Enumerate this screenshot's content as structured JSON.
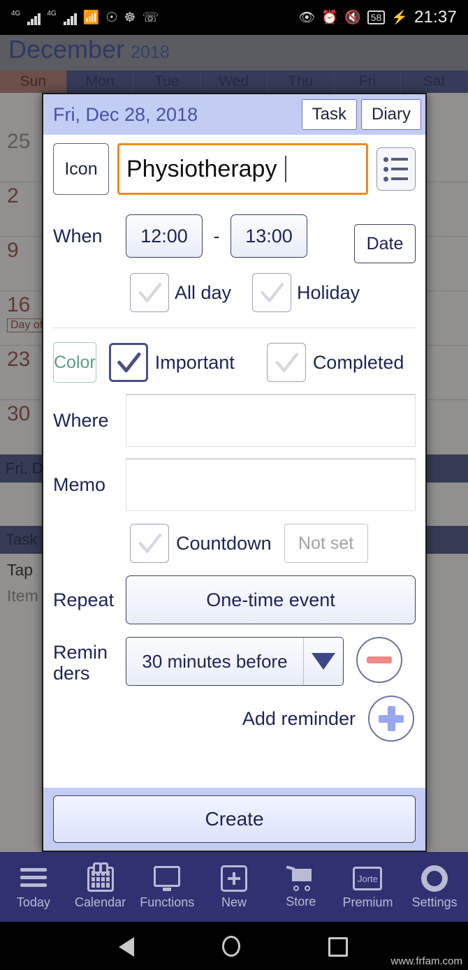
{
  "status_bar": {
    "network_label": "4G",
    "icons": [
      "signal-4g-1",
      "signal-4g-2",
      "wifi-icon",
      "whatsapp-icon",
      "contacts-icon",
      "phone-icon"
    ],
    "right_icons": [
      "eye-icon",
      "alarm-icon",
      "mute-icon"
    ],
    "battery": "58",
    "charging_icon": "charging-bolt",
    "time": "21:37"
  },
  "calendar": {
    "month": "December",
    "year": "2018",
    "day_headers": [
      "Sun",
      "Mon",
      "Tue",
      "Wed",
      "Thu",
      "Fri",
      "Sat"
    ],
    "week_numbers": [
      "25",
      "2",
      "9",
      "16",
      "23",
      "30"
    ],
    "day_of_chip": "Day of",
    "band_label": "Fri, D",
    "task_label": "Task",
    "tap_label": "Tap",
    "item_label": "Item"
  },
  "dialog": {
    "header": {
      "date": "Fri, Dec 28, 2018",
      "task_button": "Task",
      "diary_button": "Diary"
    },
    "title_row": {
      "icon_button": "Icon",
      "title_value": "Physiotherapy",
      "template_icon": "list-template-icon"
    },
    "when": {
      "label": "When",
      "start_time": "12:00",
      "separator": "-",
      "end_time": "13:00",
      "date_button": "Date",
      "all_day": {
        "label": "All day",
        "checked": false
      },
      "holiday": {
        "label": "Holiday",
        "checked": false
      }
    },
    "flags": {
      "color_button": "Color",
      "color_button_color": "#5a9e8a",
      "important": {
        "label": "Important",
        "checked": true
      },
      "completed": {
        "label": "Completed",
        "checked": false
      }
    },
    "where": {
      "label": "Where",
      "value": ""
    },
    "memo": {
      "label": "Memo",
      "value": ""
    },
    "countdown": {
      "label": "Countdown",
      "checked": false,
      "value_button": "Not set"
    },
    "repeat": {
      "label": "Repeat",
      "value": "One-time event"
    },
    "reminders": {
      "label": "Remin\nders",
      "label_line1": "Remin",
      "label_line2": "ders",
      "value": "30 minutes before",
      "dropdown_icon": "chevron-down-icon",
      "remove_icon": "minus-circle-icon",
      "add_label": "Add reminder",
      "add_icon": "plus-circle-icon"
    },
    "footer": {
      "create_button": "Create"
    }
  },
  "bottom_nav": [
    {
      "label": "Today",
      "icon": "hamburger-icon"
    },
    {
      "label": "Calendar",
      "icon": "calendar-icon"
    },
    {
      "label": "Functions",
      "icon": "monitor-icon"
    },
    {
      "label": "New",
      "icon": "plus-square-icon"
    },
    {
      "label": "Store",
      "icon": "cart-icon"
    },
    {
      "label": "Premium",
      "icon": "jorte-book-icon"
    },
    {
      "label": "Settings",
      "icon": "gear-icon"
    }
  ],
  "premium_icon_text": "Jorte",
  "system_nav": {
    "back": "back-triangle-icon",
    "home": "home-circle-icon",
    "recents": "recents-square-icon"
  },
  "watermark": "www.frfam.com"
}
